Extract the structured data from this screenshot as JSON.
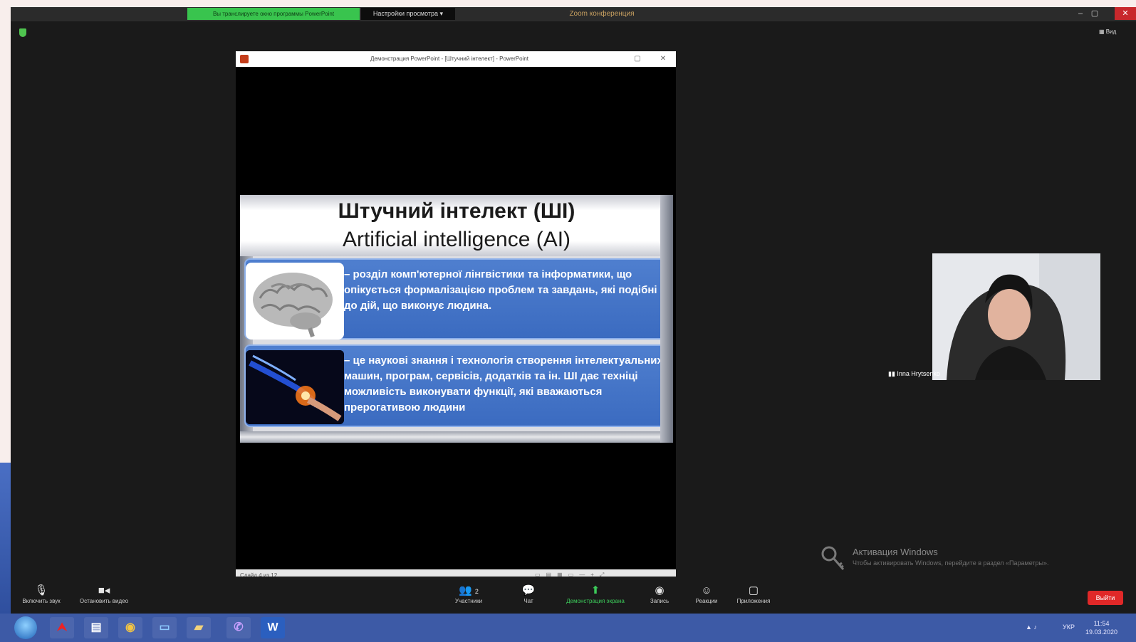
{
  "zoom": {
    "title_bar": {
      "sharing_status": "Вы транслируете окно программы PowerPoint",
      "view_options": "Настройки просмотра ▾",
      "conference_title": "Zoom конференция",
      "minimize": "–",
      "maximize": "▢",
      "close": "✕"
    },
    "view_toggle": "▦ Вид",
    "participant_name": "Inna Hrytsenko",
    "toolbar": {
      "mute_label": "Включить звук",
      "video_label": "Остановить видео",
      "participants_label": "Участники",
      "participants_count": "2",
      "chat_label": "Чат",
      "share_label": "Демонстрация экрана",
      "record_label": "Запись",
      "reactions_label": "Реакции",
      "apps_label": "Приложения",
      "end_label": "Выйти"
    }
  },
  "powerpoint": {
    "window_title": "Демонстрация PowerPoint - [Штучний інтелект] - PowerPoint",
    "slide": {
      "title_ua": "Штучний інтелект (ШІ)",
      "title_en": "Artificial intelligence (AI)",
      "definition_1": "– розділ комп'ютерної лінгвістики та інформатики, що опікується формалізацією проблем та завдань, які подібні до дій, що виконує людина.",
      "definition_2": "– це наукові знання і технологія створення інтелектуальних машин, програм, сервісів, додатків та ін. ШІ дає техніці можливість виконувати функції, які вважаються прерогативою людини"
    },
    "status_slide_number": "Слайд 4 из 12"
  },
  "windows": {
    "activation_title": "Активация Windows",
    "activation_text": "Чтобы активировать Windows, перейдите в раздел «Параметры».",
    "language": "УКР",
    "time": "11:54",
    "date": "19.03.2020",
    "taskbar_apps": [
      "Adobe Acrobat",
      "Word document",
      "Google Chrome",
      "Zoom",
      "File Explorer",
      "Viber",
      "Microsoft Word"
    ]
  },
  "colors": {
    "zoom_background": "#1a1a1a",
    "sharing_green": "#39c44e",
    "slide_box_blue": "#3b6bc0",
    "taskbar_blue": "#3d5aa6",
    "end_red": "#e02828"
  }
}
